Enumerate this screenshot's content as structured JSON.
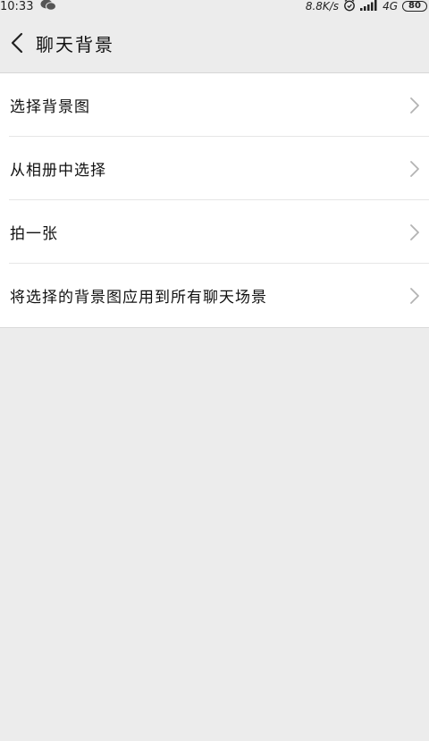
{
  "status_bar": {
    "time": "10:33",
    "left_icon": "wechat-icon",
    "network_speed": "8.8K/s",
    "alarm_icon": "alarm-clock-icon",
    "signal_icon": "signal-bars-icon",
    "network_type": "4G",
    "battery_level": "80"
  },
  "header": {
    "back_icon": "back-arrow-icon",
    "title": "聊天背景"
  },
  "menu": {
    "items": [
      {
        "label": "选择背景图"
      },
      {
        "label": "从相册中选择"
      },
      {
        "label": "拍一张"
      },
      {
        "label": "将选择的背景图应用到所有聊天场景"
      }
    ],
    "chevron_icon": "chevron-right-icon"
  },
  "colors": {
    "background": "#ececec",
    "list_background": "#ffffff",
    "divider": "#e6e6e6",
    "text": "#111111",
    "chevron": "#b3b3b3"
  }
}
